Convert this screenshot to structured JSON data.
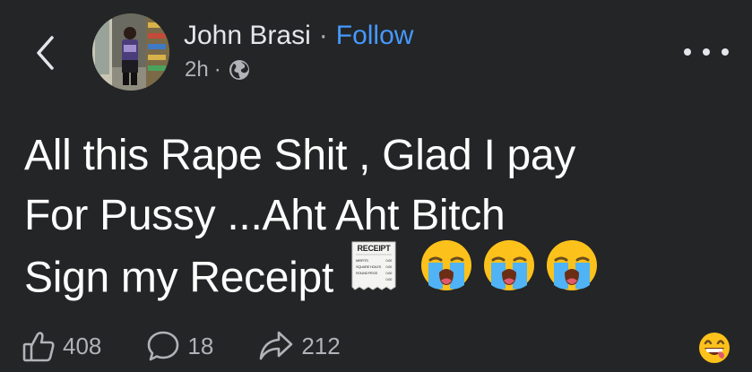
{
  "header": {
    "author_name": "John Brasi",
    "separator": "·",
    "follow_label": "Follow",
    "timestamp": "2h",
    "meta_separator": "·",
    "audience_icon": "globe-icon",
    "back_icon": "chevron-left-icon",
    "more_icon": "more-horizontal-icon"
  },
  "post": {
    "line1": "All this Rape Shit , Glad I pay",
    "line2": "For Pussy ...Aht Aht Bitch",
    "line3": "Sign my Receipt",
    "receipt_emoji": {
      "title": "RECEIPT",
      "rows": [
        {
          "label": "MISFITS",
          "value": "0.00"
        },
        {
          "label": "SQUARE HOLES",
          "value": "0.00"
        },
        {
          "label": "ROUND PEGS",
          "value": "0.00"
        },
        {
          "label": "",
          "value": "0.00"
        }
      ]
    },
    "trailing_emojis": [
      "loudly-crying-face",
      "loudly-crying-face",
      "loudly-crying-face"
    ]
  },
  "actions": {
    "likes": "408",
    "comments": "18",
    "shares": "212",
    "like_icon": "thumbs-up-icon",
    "comment_icon": "comment-bubble-icon",
    "share_icon": "share-arrow-icon",
    "reaction_icon": "grinning-face-icon"
  },
  "colors": {
    "background": "#242526",
    "text_primary": "#e4e6eb",
    "text_secondary": "#b0b3b8",
    "link_blue": "#4599ff"
  }
}
